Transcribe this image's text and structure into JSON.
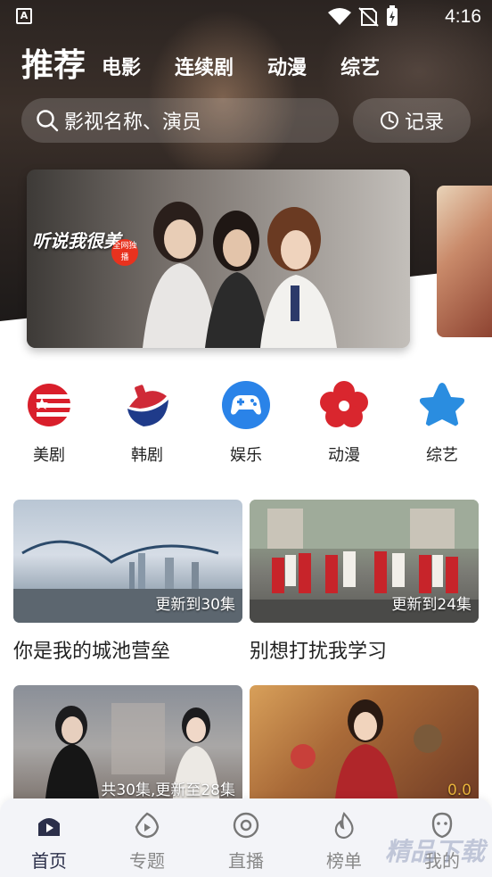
{
  "status_bar": {
    "time": "4:16"
  },
  "nav": {
    "tabs": [
      {
        "label": "推荐",
        "active": true
      },
      {
        "label": "电影"
      },
      {
        "label": "连续剧"
      },
      {
        "label": "动漫"
      },
      {
        "label": "综艺"
      }
    ]
  },
  "search": {
    "placeholder": "影视名称、演员"
  },
  "history_label": "记录",
  "banner": {
    "main_image_title": "听说我很美",
    "tag": "全网独播"
  },
  "categories": [
    {
      "label": "美剧",
      "icon": "us-flag-icon",
      "color": "#d91f2b"
    },
    {
      "label": "韩剧",
      "icon": "kr-flag-icon",
      "color": "#cf2a37"
    },
    {
      "label": "娱乐",
      "icon": "gamepad-icon",
      "color": "#2a83e8"
    },
    {
      "label": "动漫",
      "icon": "flower-icon",
      "color": "#d9262e"
    },
    {
      "label": "综艺",
      "icon": "star-icon",
      "color": "#2a8de0"
    }
  ],
  "cards": [
    {
      "title": "你是我的城池营垒",
      "badge": "更新到30集"
    },
    {
      "title": "别想打扰我学习",
      "badge": "更新到24集"
    },
    {
      "title": "",
      "badge": "共30集,更新至28集"
    },
    {
      "title": "",
      "badge": "0.0"
    }
  ],
  "bottom_nav": [
    {
      "label": "首页",
      "icon": "home-play-icon",
      "active": true
    },
    {
      "label": "专题",
      "icon": "topic-icon"
    },
    {
      "label": "直播",
      "icon": "live-icon"
    },
    {
      "label": "榜单",
      "icon": "flame-icon"
    },
    {
      "label": "我的",
      "icon": "profile-icon"
    }
  ],
  "watermark": "精品下载"
}
